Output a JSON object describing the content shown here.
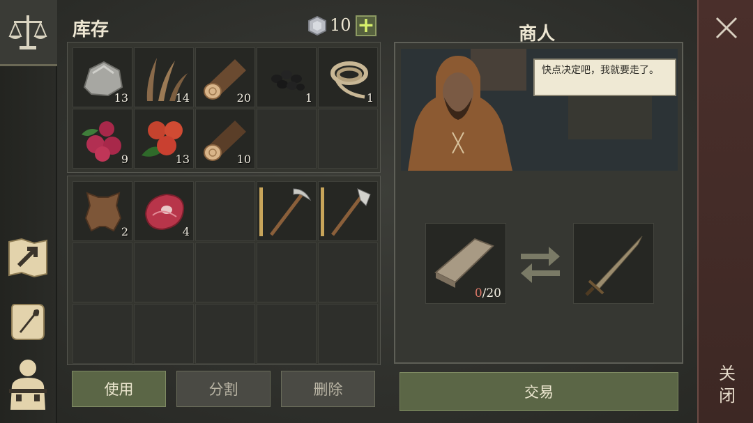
{
  "inventory": {
    "title": "库存",
    "currency": {
      "amount": "10",
      "add_label": "+"
    },
    "top_items": [
      {
        "name": "stone",
        "count": "13"
      },
      {
        "name": "fiber",
        "count": "14"
      },
      {
        "name": "log",
        "count": "20"
      },
      {
        "name": "coal",
        "count": "1"
      },
      {
        "name": "rope",
        "count": "1"
      },
      {
        "name": "berries",
        "count": "9"
      },
      {
        "name": "apples",
        "count": "13"
      },
      {
        "name": "log",
        "count": "10"
      }
    ],
    "bottom_items": [
      {
        "name": "leather",
        "count": "2"
      },
      {
        "name": "meat",
        "count": "4"
      },
      {
        "name": "pickaxe",
        "count": ""
      },
      {
        "name": "axe",
        "count": ""
      }
    ],
    "buttons": {
      "use": "使用",
      "split": "分割",
      "delete": "删除"
    }
  },
  "merchant": {
    "title": "商人",
    "speech": "快点决定吧，我就要走了。",
    "trade": {
      "have": "0",
      "need": "/20",
      "trade_button": "交易"
    }
  },
  "close": {
    "label": "关闭"
  },
  "colors": {
    "accent_green": "#5b6646",
    "close_bar": "#4a2f2b",
    "count_red": "#e07a6a"
  }
}
